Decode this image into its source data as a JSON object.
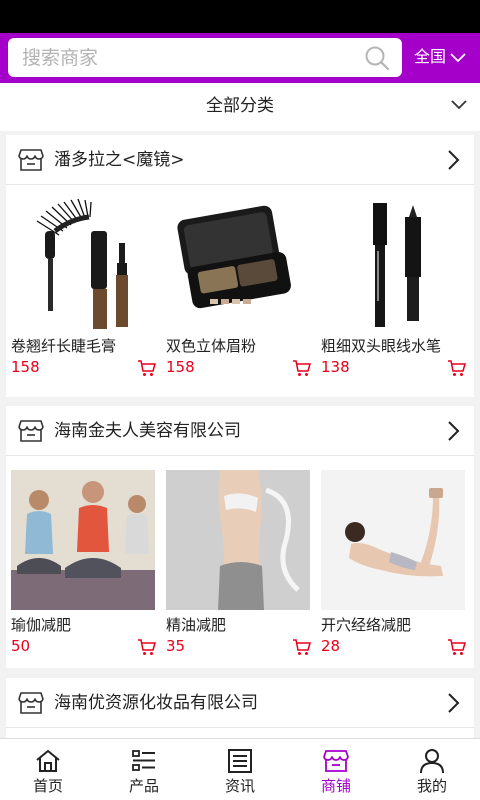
{
  "search": {
    "placeholder": "搜索商家"
  },
  "region": {
    "label": "全国"
  },
  "category": {
    "label": "全部分类"
  },
  "stores": [
    {
      "name": "潘多拉之<魔镜>",
      "products": [
        {
          "name": "卷翘纤长睫毛膏",
          "price": "158"
        },
        {
          "name": "双色立体眉粉",
          "price": "158"
        },
        {
          "name": "粗细双头眼线水笔",
          "price": "138"
        }
      ]
    },
    {
      "name": "海南金夫人美容有限公司",
      "products": [
        {
          "name": "瑜伽减肥",
          "price": "50"
        },
        {
          "name": "精油减肥",
          "price": "35"
        },
        {
          "name": "开穴经络减肥",
          "price": "28"
        }
      ]
    },
    {
      "name": "海南优资源化妆品有限公司",
      "products": []
    }
  ],
  "nav": [
    {
      "label": "首页",
      "icon": "home-icon"
    },
    {
      "label": "产品",
      "icon": "list-icon"
    },
    {
      "label": "资讯",
      "icon": "news-icon"
    },
    {
      "label": "商铺",
      "icon": "store-icon"
    },
    {
      "label": "我的",
      "icon": "user-icon"
    }
  ],
  "colors": {
    "accent": "#a500ca",
    "price": "#e8001b"
  }
}
